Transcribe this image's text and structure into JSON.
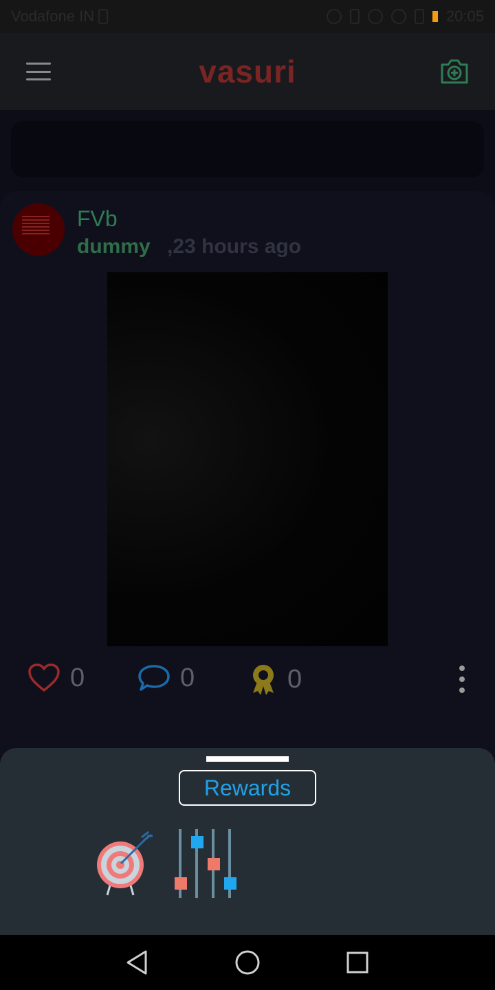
{
  "status_bar": {
    "carrier": "Vodafone IN",
    "time": "20:05",
    "battery_color": "#f39c12"
  },
  "header": {
    "title": "vasuri",
    "title_color": "#7a2424",
    "menu_icon": "menu-icon",
    "camera_icon": "camera-plus-icon",
    "camera_color": "#2e7d57"
  },
  "post": {
    "title": "FVb",
    "author": "dummy",
    "time": ",23 hours ago",
    "likes": "0",
    "comments": "0",
    "awards": "0",
    "like_color": "#9b2b2b",
    "comment_color": "#1c6aa8",
    "award_color": "#8c7a1a"
  },
  "sheet": {
    "rewards_label": "Rewards",
    "rewards_color": "#1fa2e8",
    "options": [
      {
        "icon": "target-icon"
      },
      {
        "icon": "sliders-icon"
      }
    ]
  },
  "nav": {
    "back_icon": "back-triangle-icon",
    "home_icon": "home-circle-icon",
    "recents_icon": "recents-square-icon"
  }
}
